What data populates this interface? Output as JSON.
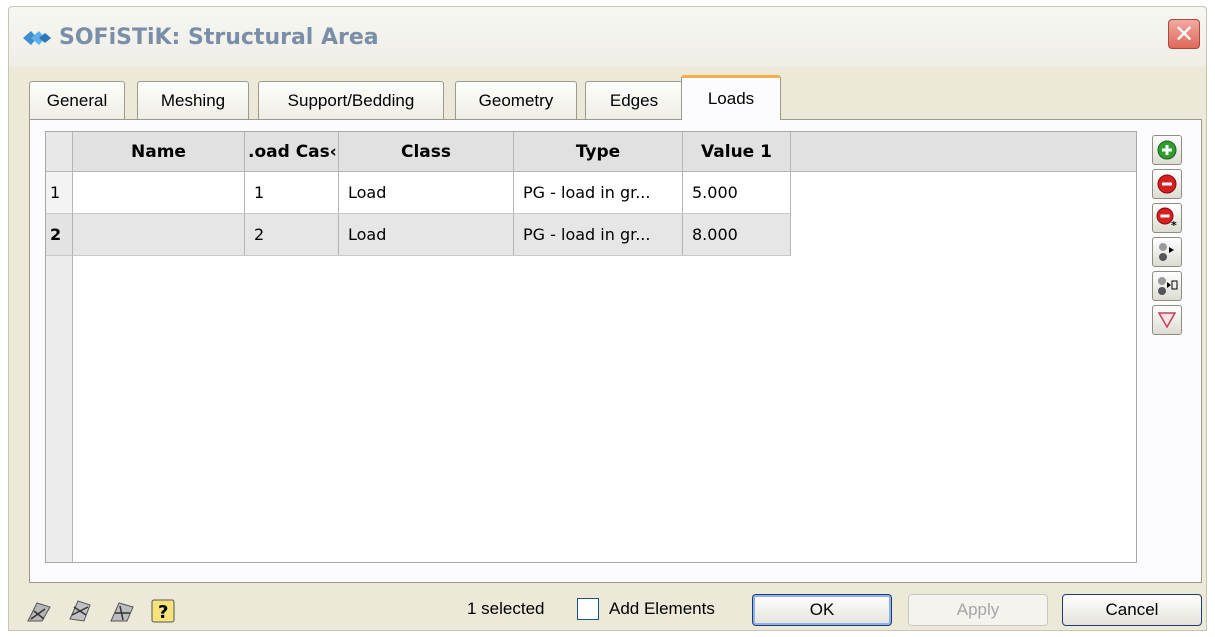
{
  "window": {
    "title": "SOFiSTiK: Structural Area"
  },
  "tabs": [
    {
      "label": "General"
    },
    {
      "label": "Meshing"
    },
    {
      "label": "Support/Bedding"
    },
    {
      "label": "Geometry"
    },
    {
      "label": "Edges"
    },
    {
      "label": "Loads",
      "active": true
    }
  ],
  "table": {
    "columns": [
      "Name",
      ".oad Cas‹",
      "Class",
      "Type",
      "Value 1"
    ],
    "rows": [
      {
        "index": "1",
        "name": "",
        "load_case": "1",
        "class": "Load",
        "type": "PG - load in gr...",
        "value1": "5.000"
      },
      {
        "index": "2",
        "name": "",
        "load_case": "2",
        "class": "Load",
        "type": "PG - load in gr...",
        "value1": "8.000",
        "selected": true
      }
    ]
  },
  "toolbar_icons": [
    "add-row-icon",
    "delete-row-icon",
    "delete-all-rows-icon",
    "move-down-icon",
    "move-to-icon",
    "eraser-icon"
  ],
  "footer": {
    "icons": [
      "pick-element-icon",
      "select-element-icon",
      "grid-element-icon",
      "help-icon"
    ],
    "selected_text": "1 selected",
    "add_elements_label": "Add Elements",
    "add_elements_checked": false,
    "ok_label": "OK",
    "apply_label": "Apply",
    "cancel_label": "Cancel"
  },
  "colors": {
    "tab_active_accent": "#f3b04a",
    "title_text": "#7a8ea8",
    "add_green": "#2f9e2f",
    "delete_red": "#d81e1e"
  }
}
